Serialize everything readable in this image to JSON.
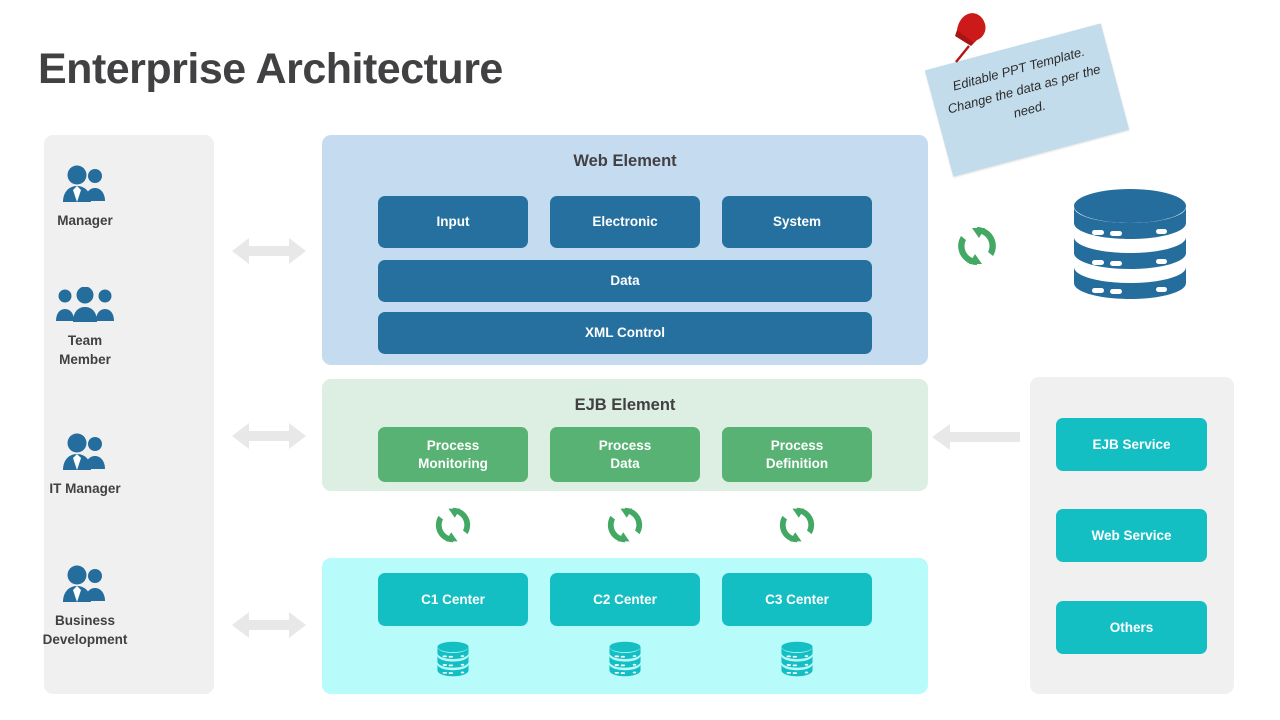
{
  "page": {
    "title": "Enterprise Architecture",
    "background_color": "#ffffff",
    "title_color": "#414042"
  },
  "sticky_note": {
    "text": "Editable PPT Template. Change the data as per the need.",
    "background_color": "#c3dceb",
    "pin_color": "#cc1a1a",
    "pin_icon": "pushpin-icon"
  },
  "personas": {
    "panel_color": "#f0f0f0",
    "items": [
      {
        "label": "Manager",
        "icon": "people-pair-icon",
        "icon_color": "#256d9c"
      },
      {
        "label": "Team\nMember",
        "icon": "people-group-icon",
        "icon_color": "#256d9c"
      },
      {
        "label": "IT Manager",
        "icon": "people-pair-icon",
        "icon_color": "#256d9c"
      },
      {
        "label": "Business\nDevelopment",
        "icon": "people-pair-icon",
        "icon_color": "#256d9c"
      }
    ]
  },
  "layers": {
    "web": {
      "title": "Web Element",
      "panel_color": "#c5dcf0",
      "card_color": "#26709f",
      "top_cards": [
        "Input",
        "Electronic",
        "System"
      ],
      "wide_cards": [
        "Data",
        "XML Control"
      ]
    },
    "ejb": {
      "title": "EJB Element",
      "panel_color": "#dcefe2",
      "card_color": "#58b273",
      "cards": [
        "Process\nMonitoring",
        "Process\nData",
        "Process\nDefinition"
      ]
    },
    "data_center": {
      "panel_color": "#b8fbfb",
      "card_color": "#14bfc4",
      "cards": [
        "C1 Center",
        "C2 Center",
        "C3 Center"
      ],
      "db_icon": "database-icon",
      "db_icon_color": "#14bfc4"
    }
  },
  "services": {
    "panel_color": "#f0f0f0",
    "card_color": "#14bfc4",
    "items": [
      "EJB Service",
      "Web Service",
      "Others"
    ]
  },
  "icons": {
    "sync": {
      "name": "sync-refresh-icon",
      "color": "#43a864"
    },
    "arrow_double": {
      "name": "double-arrow-icon",
      "color": "#e8e8e8"
    },
    "arrow_left": {
      "name": "left-arrow-icon",
      "color": "#e8e8e8"
    },
    "big_database": {
      "name": "database-icon",
      "color": "#256d9c"
    }
  }
}
